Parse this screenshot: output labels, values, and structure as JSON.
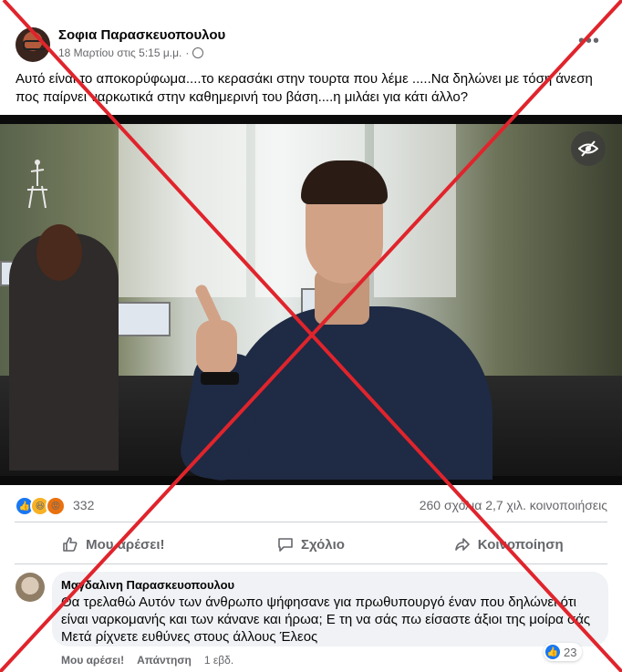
{
  "post": {
    "author": "Σοφια Παρασκευοπουλου",
    "timestamp": "18 Μαρτίου στις 5:15 μ.μ.",
    "audience_icon": "globe-icon",
    "more_icon": "•••",
    "text": "Αυτό είναι το αποκορύφωμα....το κερασάκι στην τουρτα που  λέμε .....Να δηλώνει με τόση άνεση πος παίρνει ναρκωτικά στην καθημερινή του βάση....η μιλάει για κάτι άλλο?"
  },
  "video": {
    "hide_icon": "eye-slash-icon"
  },
  "stats": {
    "reaction_count": "332",
    "comments_shares": "260 σχόλια  2,7 χιλ. κοινοποιήσεις",
    "reaction_icons": [
      "like",
      "haha",
      "angry"
    ]
  },
  "actions": {
    "like": "Μου αρέσει!",
    "comment": "Σχόλιο",
    "share": "Κοινοποίηση"
  },
  "comment": {
    "author": "Μαγδαλινη Παρασκευοπουλου",
    "text": "Θα τρελαθώ Αυτόν των άνθρωπο ψήφησανε για πρωθυπουργό έναν που δηλώνει ότι είναι ναρκομανής και των κάνανε και ήρωα; Ε τη να σάς πω είσαστε άξιοι της μοίρα σάς Μετά ρίχνετε ευθύνες στους άλλους Έλεος",
    "like_label": "Μου αρέσει!",
    "reply_label": "Απάντηση",
    "age": "1 εβδ.",
    "like_count": "23"
  },
  "colors": {
    "accent": "#1877f2",
    "muted_text": "#65676b",
    "overlay_x": "#e0242c"
  }
}
